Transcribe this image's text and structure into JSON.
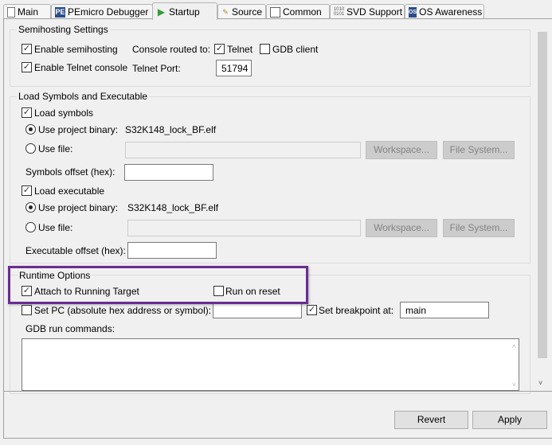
{
  "tabs": [
    {
      "label": "Main",
      "icon": "document-icon"
    },
    {
      "label": "PEmicro Debugger",
      "icon": "pemicro-icon"
    },
    {
      "label": "Startup",
      "icon": "play-icon",
      "selected": true
    },
    {
      "label": "Source",
      "icon": "source-icon"
    },
    {
      "label": "Common",
      "icon": "table-icon"
    },
    {
      "label": "SVD Support",
      "icon": "binary-icon"
    },
    {
      "label": "OS Awareness",
      "icon": "os-icon"
    }
  ],
  "semihosting": {
    "title": "Semihosting Settings",
    "enable_semihosting": {
      "label": "Enable semihosting",
      "checked": true
    },
    "console_routed_label": "Console routed to:",
    "telnet": {
      "label": "Telnet",
      "checked": true
    },
    "gdb_client": {
      "label": "GDB client",
      "checked": false
    },
    "enable_telnet_console": {
      "label": "Enable Telnet console",
      "checked": true
    },
    "telnet_port_label": "Telnet Port:",
    "telnet_port_value": "51794"
  },
  "load": {
    "title": "Load Symbols and Executable",
    "load_symbols": {
      "label": "Load symbols",
      "checked": true
    },
    "sym_use_project_binary": "Use project binary:",
    "sym_binary_value": "S32K148_lock_BF.elf",
    "sym_use_file": "Use file:",
    "workspace": "Workspace...",
    "file_system": "File System...",
    "symbols_offset_label": "Symbols offset (hex):",
    "load_executable": {
      "label": "Load executable",
      "checked": true
    },
    "exe_use_project_binary": "Use project binary:",
    "exe_binary_value": "S32K148_lock_BF.elf",
    "exe_use_file": "Use file:",
    "executable_offset_label": "Executable offset (hex):"
  },
  "runtime": {
    "title": "Runtime Options",
    "attach": {
      "label": "Attach to Running Target",
      "checked": true
    },
    "run_on_reset": {
      "label": "Run on reset",
      "checked": false
    },
    "set_pc": {
      "label": "Set PC (absolute hex address or symbol):",
      "checked": false
    },
    "set_breakpoint": {
      "label": "Set breakpoint at:",
      "checked": true
    },
    "breakpoint_value": "main",
    "gdb_run_commands_label": "GDB run commands:"
  },
  "buttons": {
    "revert": "Revert",
    "apply": "Apply"
  },
  "colors": {
    "highlight": "#6a2c91"
  }
}
